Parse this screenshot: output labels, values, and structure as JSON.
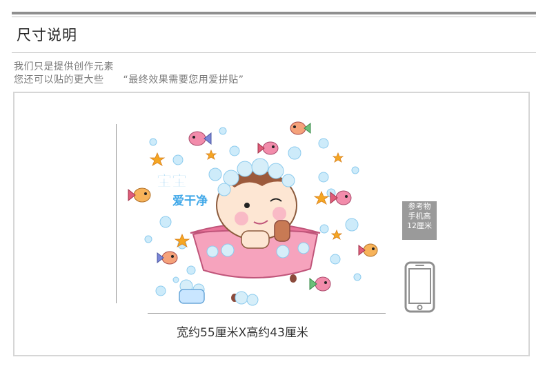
{
  "section": {
    "title": "尺寸说明"
  },
  "intro": {
    "line1": "我们只是提供创作元素",
    "line2": "您还可以贴的更大些",
    "quote": "“最终效果需要您用爱拼贴”"
  },
  "sticker": {
    "title_line1": "宝宝",
    "title_line2": "爱干净",
    "size_label": "宽约55厘米X高约43厘米"
  },
  "reference": {
    "line1": "参考物",
    "line2": "手机高",
    "line3": "12厘米"
  },
  "colors": {
    "rule_dark": "#8f8f8f",
    "bubble": "#b9e2f7",
    "tub": "#f28cab",
    "star": "#f5a623",
    "title_blue": "#3fa7e8",
    "ref_gray": "#9a9a9a"
  },
  "icons": [
    "phone-icon",
    "fish-icon",
    "star-icon",
    "bubble-icon",
    "soap-icon"
  ]
}
